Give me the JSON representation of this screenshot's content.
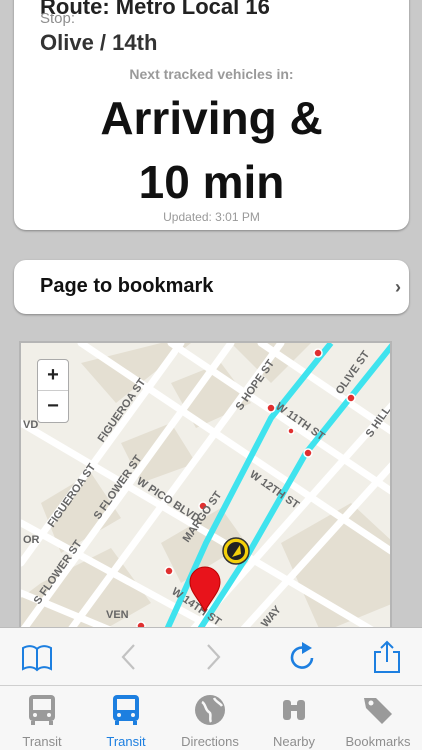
{
  "arrival": {
    "route_title": "Route: Metro Local 16",
    "stop_label": "Stop:",
    "stop_name": "Olive / 14th",
    "next_label": "Next tracked vehicles in:",
    "time_line1": "Arriving &",
    "time_line2": "10 min",
    "updated": "Updated: 3:01 PM"
  },
  "bookmark": {
    "label": "Page to bookmark",
    "chevron": "›"
  },
  "map": {
    "zoom_in": "+",
    "zoom_out": "−",
    "street_labels": {
      "figueroa1": "FIGUEROA ST",
      "figueroa2": "FIGUEROA ST",
      "flower1": "S FLOWER ST",
      "flower2": "S FLOWER ST",
      "hope": "S HOPE ST",
      "olive": "OLIVE ST",
      "hill": "S HILL",
      "w11th": "W 11TH ST",
      "w12th": "W 12TH ST",
      "pico": "W PICO BLVD",
      "margo": "MARGO ST",
      "w14th": "W 14TH ST",
      "venice": "VEN",
      "way": "WAY",
      "vd": "VD",
      "or": "OR"
    },
    "route_color": "#3fe3ee",
    "pin_color": "#e8131b"
  },
  "toolbar": {
    "bookmarks_icon": "book-icon",
    "back_icon": "chevron-left-icon",
    "forward_icon": "chevron-right-icon",
    "reload_icon": "reload-icon",
    "share_icon": "share-icon"
  },
  "tabs": [
    {
      "label": "Transit",
      "icon": "bus-icon",
      "active": false
    },
    {
      "label": "Transit",
      "icon": "bus-icon",
      "active": true
    },
    {
      "label": "Directions",
      "icon": "globe-icon",
      "active": false
    },
    {
      "label": "Nearby",
      "icon": "binoculars-icon",
      "active": false
    },
    {
      "label": "Bookmarks",
      "icon": "tag-icon",
      "active": false
    }
  ],
  "colors": {
    "accent": "#1d7fe0",
    "inactive": "#8e8e8e"
  }
}
